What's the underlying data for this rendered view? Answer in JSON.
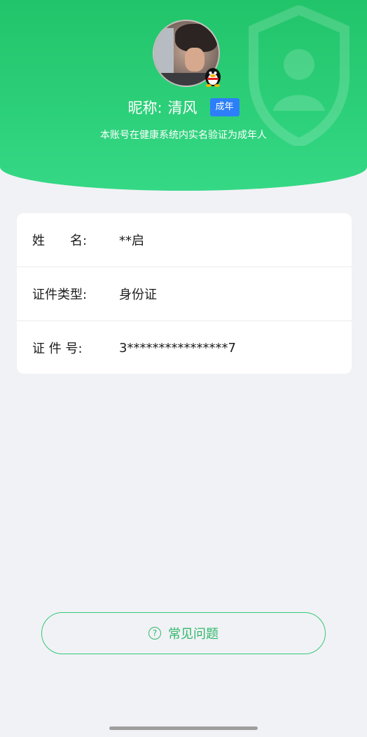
{
  "profile": {
    "nickname_label": "昵称:",
    "nickname": "清风",
    "age_tag": "成年",
    "verify_text": "本账号在健康系统内实名验证为成年人",
    "avatar_badge_icon": "qq-penguin-icon"
  },
  "info": {
    "rows": [
      {
        "key": "姓　　名:",
        "value": "**启"
      },
      {
        "key": "证件类型:",
        "value": "身份证"
      },
      {
        "key": "证 件 号:",
        "value": "3****************7"
      }
    ]
  },
  "faq": {
    "icon": "question-circle-icon",
    "label": "常见问题"
  },
  "colors": {
    "header_green": "#22c46a",
    "tag_blue": "#2d7ff9",
    "faq_green": "#2fb86a",
    "background": "#f1f2f6"
  }
}
